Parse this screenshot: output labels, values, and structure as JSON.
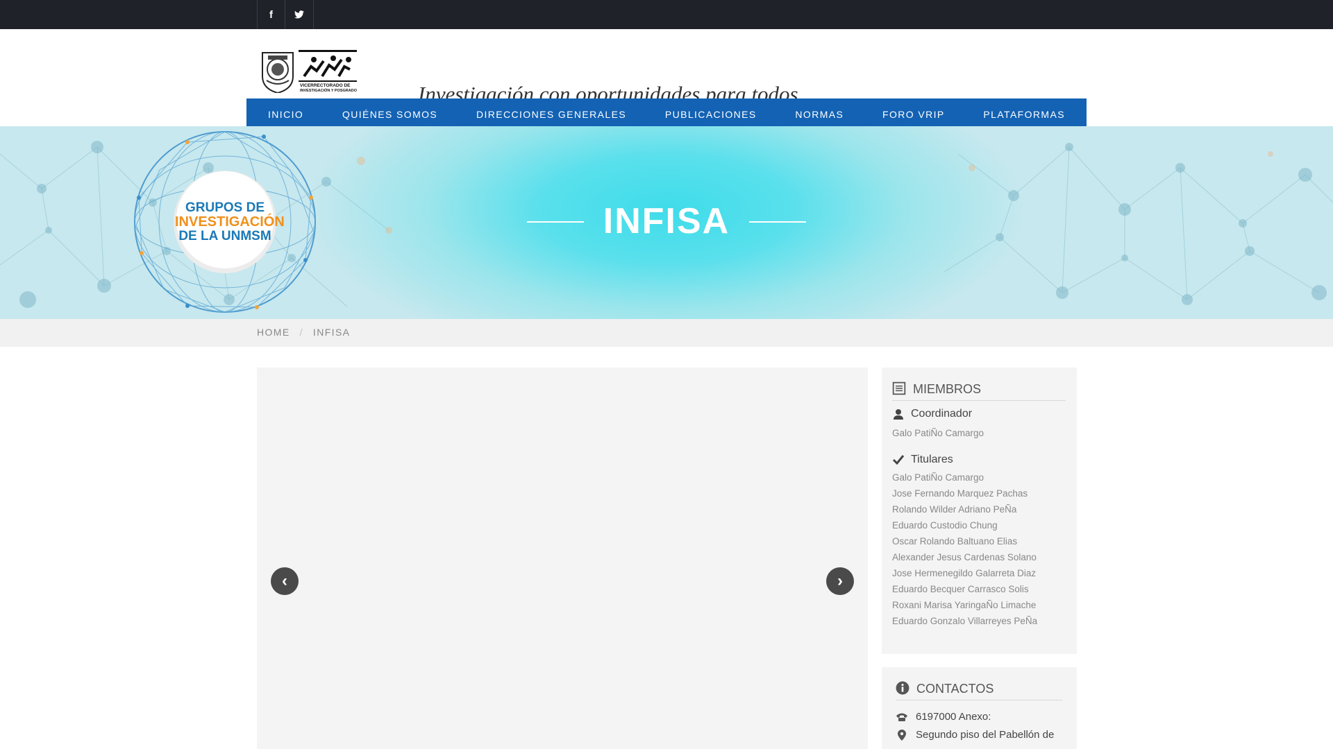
{
  "topbar": {
    "social": [
      {
        "icon": "facebook-icon",
        "glyph": "f"
      },
      {
        "icon": "twitter-icon",
        "glyph": "𝕥"
      }
    ]
  },
  "header": {
    "logo_caption_1": "VICERRECTORADO DE",
    "logo_caption_2": "INVESTIGACIÓN Y POSGRADO",
    "tagline": "Investigación con oportunidades para todos"
  },
  "nav": {
    "items": [
      {
        "label": "INICIO"
      },
      {
        "label": "QUIÉNES SOMOS"
      },
      {
        "label": "DIRECCIONES GENERALES"
      },
      {
        "label": "PUBLICACIONES"
      },
      {
        "label": "NORMAS"
      },
      {
        "label": "FORO VRIP"
      },
      {
        "label": "PLATAFORMAS"
      }
    ]
  },
  "hero": {
    "title": "INFISA",
    "badge_line1": "GRUPOS DE",
    "badge_line2": "INVESTIGACIÓN",
    "badge_line3": "DE LA UNMSM"
  },
  "breadcrumb": {
    "home": "HOME",
    "separator": "/",
    "current": "INFISA"
  },
  "carousel": {
    "prev_glyph": "‹",
    "next_glyph": "›"
  },
  "members": {
    "title": "MIEMBROS",
    "coordinator_label": "Coordinador",
    "coordinator": "Galo PatiÑo Camargo",
    "titulares_label": "Titulares",
    "titulares": [
      "Galo PatiÑo Camargo",
      "Jose Fernando Marquez Pachas",
      "Rolando Wilder Adriano PeÑa",
      "Eduardo Custodio Chung",
      "Oscar Rolando Baltuano Elias",
      "Alexander Jesus Cardenas Solano",
      "Jose Hermenegildo Galarreta Diaz",
      "Eduardo Becquer Carrasco Solis",
      "Roxani Marisa YaringaÑo Limache",
      "Eduardo Gonzalo Villarreyes PeÑa"
    ]
  },
  "contacts": {
    "title": "CONTACTOS",
    "phone": "6197000 Anexo:",
    "address": "Segundo piso del Pabellón de"
  },
  "colors": {
    "topbar": "#1f2228",
    "nav": "#1362b4",
    "hero_center": "#3fdcea",
    "panel": "#f4f4f4"
  }
}
